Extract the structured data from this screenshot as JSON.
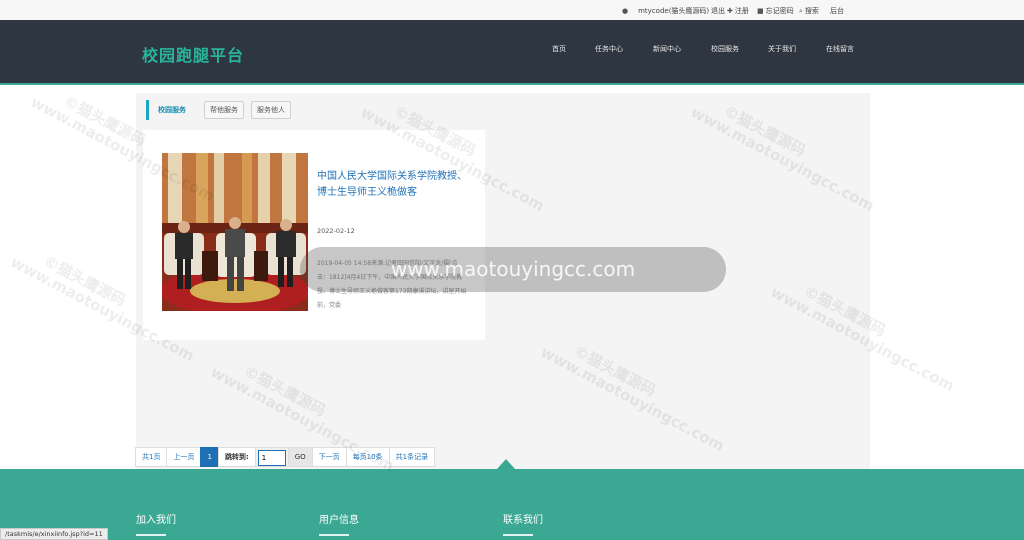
{
  "topbar": {
    "user": "mtycode(猫头鹰源码)",
    "logout": "退出",
    "register": "注册",
    "forgot": "忘记密码",
    "search": "搜索",
    "admin": "后台"
  },
  "header": {
    "logo": "校园跑腿平台",
    "nav": [
      "首页",
      "任务中心",
      "新闻中心",
      "校园服务",
      "关于我们",
      "在线留言"
    ]
  },
  "section": {
    "title": "校园服务",
    "tabs": [
      "帮他服务",
      "服务他人"
    ]
  },
  "article": {
    "title": "中国人民大学国际关系学院教授、博士生导师王义桅做客",
    "date": "2022-02-12",
    "excerpt": "2019-04-05 14:58来源:记者田同信阳/文字龙/摄[点击：1812]4月4日下午，中国人民大学国际关系学院教授、博士生导师王义桅做客第173期康溪讲坛。讲座开始前，党委"
  },
  "pagination": {
    "first": "共1页",
    "prev": "上一页",
    "current": "1",
    "jump_label": "跳转到:",
    "jump_value": "1",
    "go": "GO",
    "next": "下一页",
    "per_page": "每页10条",
    "total": "共1条记录"
  },
  "footer": {
    "col1": "加入我们",
    "col2": "用户信息",
    "col3": "联系我们"
  },
  "status_url": "/taskmis/e/xinxiinfo.jsp?id=11",
  "watermark": {
    "line1": "©猫头鹰源码",
    "line2": "www.maotouyingcc.com",
    "toast": "www.maotouyingcc.com"
  },
  "colors": {
    "header_bg": "#2e3641",
    "brand_green": "#29b59a",
    "footer_bg": "#3aa893",
    "link_blue": "#1f72b8",
    "accent_cyan": "#1aa6c1"
  }
}
